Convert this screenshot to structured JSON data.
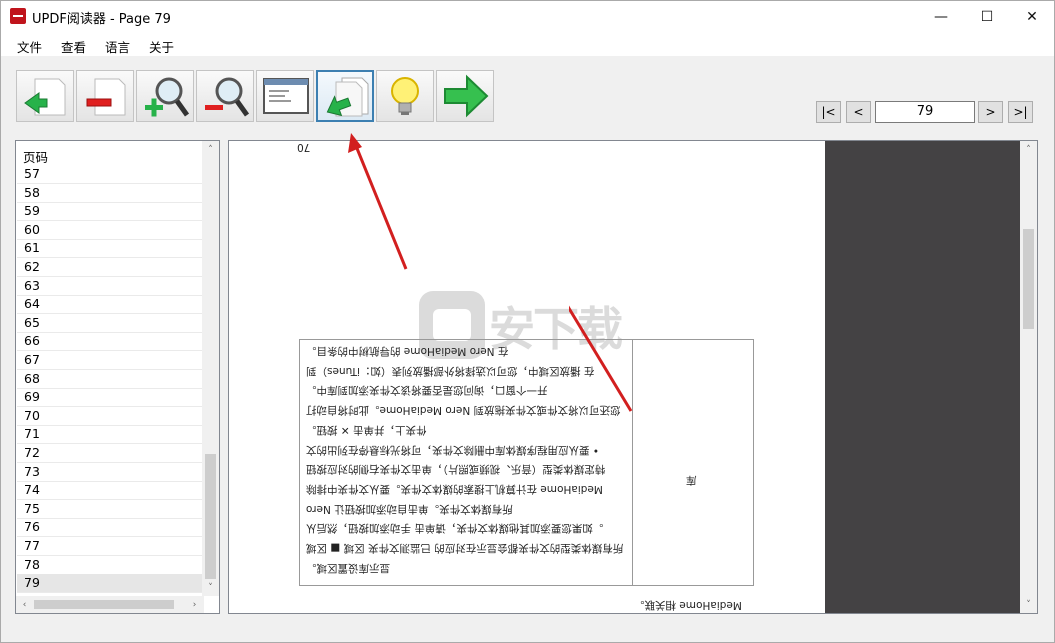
{
  "window": {
    "title": "UPDF阅读器 - Page 79",
    "controls": {
      "minimize": "—",
      "maximize": "☐",
      "close": "✕"
    }
  },
  "menu": [
    "文件",
    "查看",
    "语言",
    "关于"
  ],
  "toolbar": {
    "buttons": [
      {
        "name": "add-page-button",
        "icon": "add-page-icon"
      },
      {
        "name": "remove-page-button",
        "icon": "remove-page-icon"
      },
      {
        "name": "zoom-in-button",
        "icon": "zoom-in-icon"
      },
      {
        "name": "zoom-out-button",
        "icon": "zoom-out-icon"
      },
      {
        "name": "window-button",
        "icon": "window-icon"
      },
      {
        "name": "rotate-page-button",
        "icon": "rotate-page-icon"
      },
      {
        "name": "tips-button",
        "icon": "lightbulb-icon"
      },
      {
        "name": "next-button",
        "icon": "green-arrow-icon"
      }
    ]
  },
  "nav": {
    "first": "|<",
    "prev": "<",
    "page_value": "79",
    "next": ">",
    "last": ">|"
  },
  "sidebar": {
    "header": "页码",
    "pages": [
      "57",
      "58",
      "59",
      "60",
      "61",
      "62",
      "63",
      "64",
      "65",
      "66",
      "67",
      "68",
      "69",
      "70",
      "71",
      "72",
      "73",
      "74",
      "75",
      "76",
      "77",
      "78",
      "79"
    ],
    "selected": "79",
    "scroll_up": "˄",
    "scroll_down": "˅",
    "scroll_left": "‹",
    "scroll_right": "›"
  },
  "document": {
    "top_fragment": "70",
    "side_cell": "库",
    "bottom_text": "MediaHome 相关联。",
    "lines": [
      "在 Nero MediaHome 的导航树中的条目。",
      "在 播放区域中，您可以选择将外部播放列表（如：iTunes）到",
      "开一个窗口，询问您是否要将该文件夹添加到库中。",
      "您还可以将文件或文件夹拖放到 Nero MediaHome。此时将自动打",
      "件夹上，并单击 ✕ 按钮。",
      "• 要从应用程序媒体库中删除文件夹，可将光标悬停在列出的文",
      "特定媒体类型（音乐、视频或照片），单击文件夹右侧的对应按钮",
      "MediaHome 在计算机上搜索的媒体文件夹。要从文件夹中排除",
      "所有媒体文件夹。单击自动添加按钮让 Nero",
      "。如果您要添加其他媒体文件夹，请单击 手动添加按钮，然后从",
      "所有媒体类型的文件夹都会显示在对应的 已监测文件夹 区域 ■ 区域",
      "显示库设置区域。"
    ]
  },
  "watermark": "安下载",
  "colors": {
    "title_icon": "#c0141c",
    "active_button_border": "#3c7fb1",
    "dark_area": "#444244",
    "annotation_arrow": "#d21f1f"
  }
}
